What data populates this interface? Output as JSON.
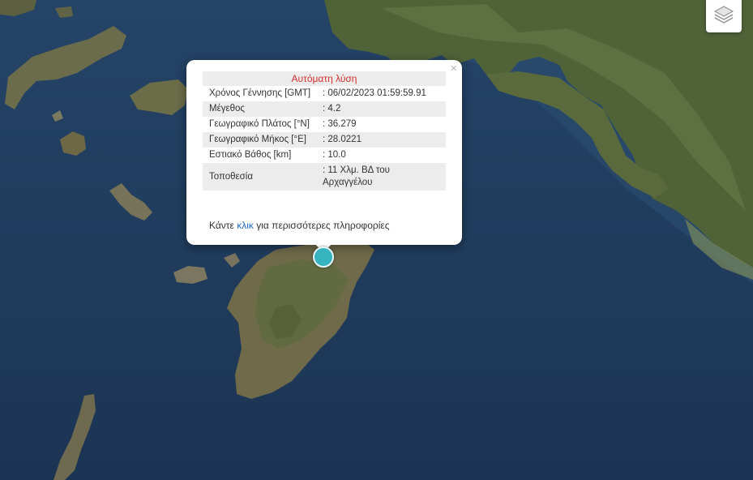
{
  "map": {
    "basemap": "satellite",
    "marker_color": "#36b3bf"
  },
  "controls": {
    "layers_icon": "layers-icon"
  },
  "popup": {
    "title": "Αυτόματη λύση",
    "title_color": "#d32f2f",
    "rows": [
      {
        "label": "Χρόνος Γέννησης [GMT]",
        "value": ": 06/02/2023 01:59:59.91"
      },
      {
        "label": "Μέγεθος",
        "value": ": 4.2"
      },
      {
        "label": "Γεωγραφικό Πλάτος [°N]",
        "value": ": 36.279"
      },
      {
        "label": "Γεωγραφικό Μήκος [°E]",
        "value": ": 28.0221"
      },
      {
        "label": "Εστιακό Βάθος [km]",
        "value": ": 10.0"
      },
      {
        "label": "Τοποθεσία",
        "value": ": 11 Χλμ. ΒΔ του Αρχαγγέλου"
      }
    ],
    "more_prefix": "Κάντε ",
    "more_link": "κλικ",
    "more_suffix": " για περισσότερες πληροφορίες",
    "close_label": "×"
  }
}
